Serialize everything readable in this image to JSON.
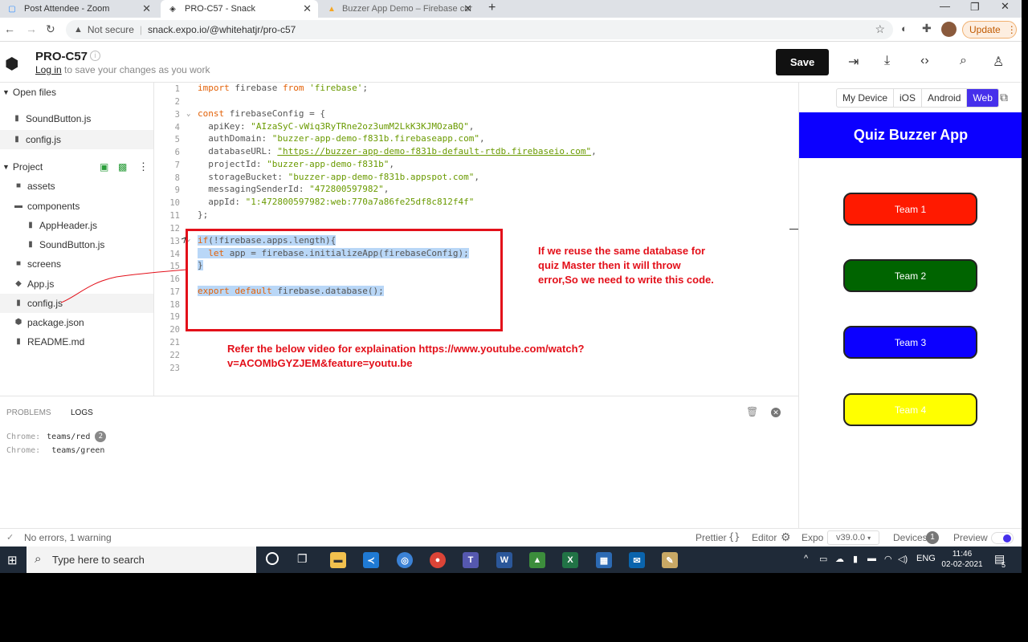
{
  "browser": {
    "tabs": [
      {
        "title": "Post Attendee - Zoom",
        "icon": "zoom-icon"
      },
      {
        "title": "PRO-C57 - Snack",
        "icon": "snack-icon"
      },
      {
        "title": "Buzzer App Demo – Firebase cor",
        "icon": "firebase-icon"
      }
    ],
    "security": "Not secure",
    "url": "snack.expo.io/@whitehatjr/pro-c57",
    "update_label": "Update"
  },
  "snack": {
    "title": "PRO-C57",
    "login_link": "Log in",
    "login_suffix": " to save your changes as you work",
    "save_label": "Save"
  },
  "sidebar": {
    "open_files_header": "Open files",
    "open_files": [
      "SoundButton.js",
      "config.js"
    ],
    "project_header": "Project",
    "tree": [
      {
        "name": "assets",
        "type": "folder",
        "indent": 0
      },
      {
        "name": "components",
        "type": "folder",
        "indent": 0
      },
      {
        "name": "AppHeader.js",
        "type": "file",
        "indent": 1
      },
      {
        "name": "SoundButton.js",
        "type": "file",
        "indent": 1
      },
      {
        "name": "screens",
        "type": "folder",
        "indent": 0
      },
      {
        "name": "App.js",
        "type": "js",
        "indent": 0
      },
      {
        "name": "config.js",
        "type": "file",
        "indent": 0
      },
      {
        "name": "package.json",
        "type": "pkg",
        "indent": 0
      },
      {
        "name": "README.md",
        "type": "file",
        "indent": 0
      }
    ]
  },
  "editor": {
    "line_numbers": [
      "1",
      "2",
      "3",
      "4",
      "5",
      "6",
      "7",
      "8",
      "9",
      "10",
      "11",
      "12",
      "13",
      "14",
      "15",
      "16",
      "17",
      "18",
      "19",
      "20",
      "21",
      "22",
      "23"
    ]
  },
  "annotations": {
    "note1": "If we reuse the same database for quiz Master then it will throw error,So we need to write this code.",
    "note2_line1": "Refer the below video for explaination  https://www.youtube.com/watch?",
    "note2_line2": "v=ACOMbGYZJEM&feature=youtu.be"
  },
  "preview": {
    "device_tabs": [
      "My Device",
      "iOS",
      "Android",
      "Web"
    ],
    "active_tab": "Web",
    "app_title": "Quiz Buzzer App",
    "teams": [
      {
        "label": "Team 1",
        "color": "#ff1a00",
        "text_color": "#ffffff"
      },
      {
        "label": "Team 2",
        "color": "#006400",
        "text_color": "#ffffff"
      },
      {
        "label": "Team 3",
        "color": "#0c00ff",
        "text_color": "#ffffff"
      },
      {
        "label": "Team 4",
        "color": "#ffff00",
        "text_color": "#ffffff"
      }
    ]
  },
  "bottom_panel": {
    "tabs": [
      "PROBLEMS",
      "LOGS"
    ],
    "logs": [
      {
        "source": "Chrome:",
        "message": "teams/red",
        "count": "2"
      },
      {
        "source": "Chrome:",
        "message": "teams/green",
        "count": ""
      }
    ]
  },
  "status": {
    "message": "No errors, 1 warning",
    "prettier": "Prettier",
    "editor": "Editor",
    "expo": "Expo",
    "version": "v39.0.0",
    "devices": "Devices",
    "devices_count": "1",
    "preview": "Preview"
  },
  "taskbar": {
    "search_placeholder": "Type here to search",
    "language": "ENG",
    "time": "11:46",
    "date": "02-02-2021",
    "notification_count": "5"
  }
}
